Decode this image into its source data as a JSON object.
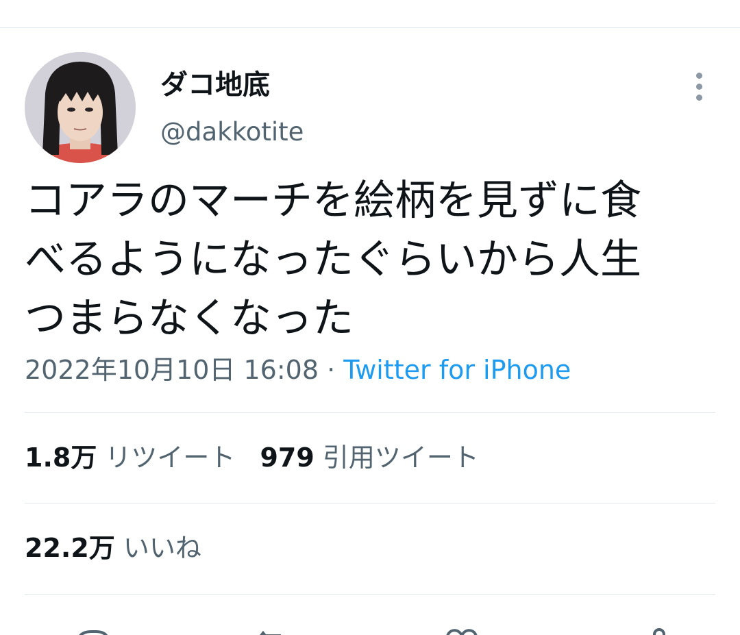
{
  "tweet": {
    "author": {
      "display_name": "ダコ地底",
      "handle": "@dakkotite"
    },
    "text_lines": [
      "コアラのマーチを絵柄を見ずに食",
      "べるようになったぐらいから人生",
      "つまらなくなった"
    ],
    "timestamp": "2022年10月10日 16:08",
    "separator": " · ",
    "source": "Twitter for iPhone"
  },
  "stats": {
    "retweets": {
      "count": "1.8万",
      "label": "リツイート"
    },
    "quotes": {
      "count": "979",
      "label": "引用ツイート"
    },
    "likes": {
      "count": "22.2万",
      "label": "いいね"
    }
  },
  "actions": [
    {
      "icon": "reply-icon"
    },
    {
      "icon": "retweet-icon"
    },
    {
      "icon": "like-icon"
    },
    {
      "icon": "share-icon"
    }
  ],
  "colors": {
    "text_primary": "#0f1419",
    "text_secondary": "#536471",
    "link": "#1d9bf0",
    "divider": "#e1e8ed"
  }
}
